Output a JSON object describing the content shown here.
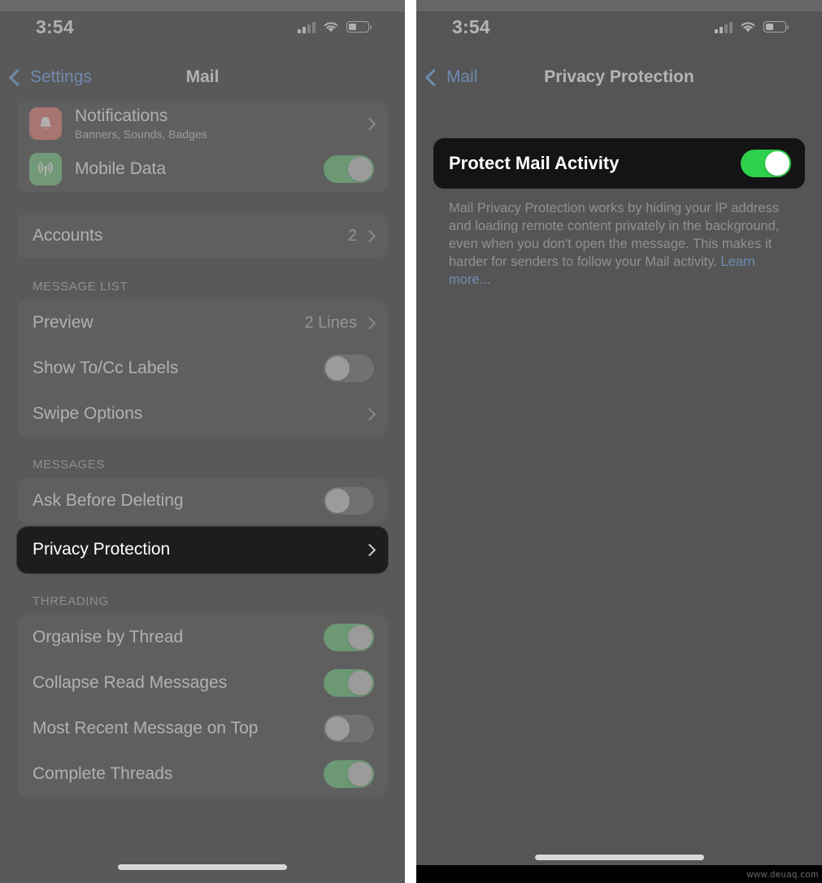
{
  "watermark": "www.deuaq.com",
  "left_phone": {
    "status_bar": {
      "time": "3:54",
      "signal_icon": "cellular-signal-icon",
      "wifi_icon": "wifi-icon",
      "battery_icon": "battery-icon"
    },
    "nav": {
      "back_label": "Settings",
      "back_icon": "chevron-left-icon",
      "title": "Mail"
    },
    "groups": [
      {
        "header": "",
        "rows": [
          {
            "label": "Notifications",
            "sublabel": "Banners, Sounds, Badges",
            "icon": "bell-icon",
            "icon_color": "#e8655c",
            "accessory": "chevron"
          },
          {
            "label": "Mobile Data",
            "sublabel": "",
            "icon": "antenna-icon",
            "icon_color": "#5cc26a",
            "accessory": "toggle",
            "toggle_on": true
          }
        ]
      },
      {
        "header": "",
        "rows": [
          {
            "label": "Accounts",
            "value": "2",
            "accessory": "chevron"
          }
        ]
      },
      {
        "header": "MESSAGE LIST",
        "rows": [
          {
            "label": "Preview",
            "value": "2 Lines",
            "accessory": "chevron"
          },
          {
            "label": "Show To/Cc Labels",
            "accessory": "toggle",
            "toggle_on": false
          },
          {
            "label": "Swipe Options",
            "accessory": "chevron"
          }
        ]
      },
      {
        "header": "MESSAGES",
        "rows": [
          {
            "label": "Ask Before Deleting",
            "accessory": "toggle",
            "toggle_on": false
          }
        ]
      },
      {
        "header": "",
        "highlighted": true,
        "rows": [
          {
            "label": "Privacy Protection",
            "accessory": "chevron"
          }
        ]
      },
      {
        "header": "THREADING",
        "rows": [
          {
            "label": "Organise by Thread",
            "accessory": "toggle",
            "toggle_on": true
          },
          {
            "label": "Collapse Read Messages",
            "accessory": "toggle",
            "toggle_on": true
          },
          {
            "label": "Most Recent Message on Top",
            "accessory": "toggle",
            "toggle_on": false
          },
          {
            "label": "Complete Threads",
            "accessory": "toggle",
            "toggle_on": true
          }
        ]
      }
    ]
  },
  "right_phone": {
    "status_bar": {
      "time": "3:54",
      "signal_icon": "cellular-signal-icon",
      "wifi_icon": "wifi-icon",
      "battery_icon": "battery-icon"
    },
    "nav": {
      "back_label": "Mail",
      "back_icon": "chevron-left-icon",
      "title": "Privacy Protection"
    },
    "main_row": {
      "label": "Protect Mail Activity",
      "toggle_on": true
    },
    "footer_text": "Mail Privacy Protection works by hiding your IP address and loading remote content privately in the background, even when you don't open the message. This makes it harder for senders to follow your Mail activity. ",
    "footer_link": "Learn more..."
  },
  "colors": {
    "accent_blue": "#5a9bf6",
    "toggle_on_green": "#4cbf63",
    "toggle_on_vivid": "#2ed04c",
    "toggle_off_grey": "#5a5a5e",
    "notifications_icon": "#e8655c",
    "mobile_data_icon": "#5cc26a",
    "card_bg": "#2c2c2e",
    "highlight_card_bg": "#1d1d1f"
  }
}
